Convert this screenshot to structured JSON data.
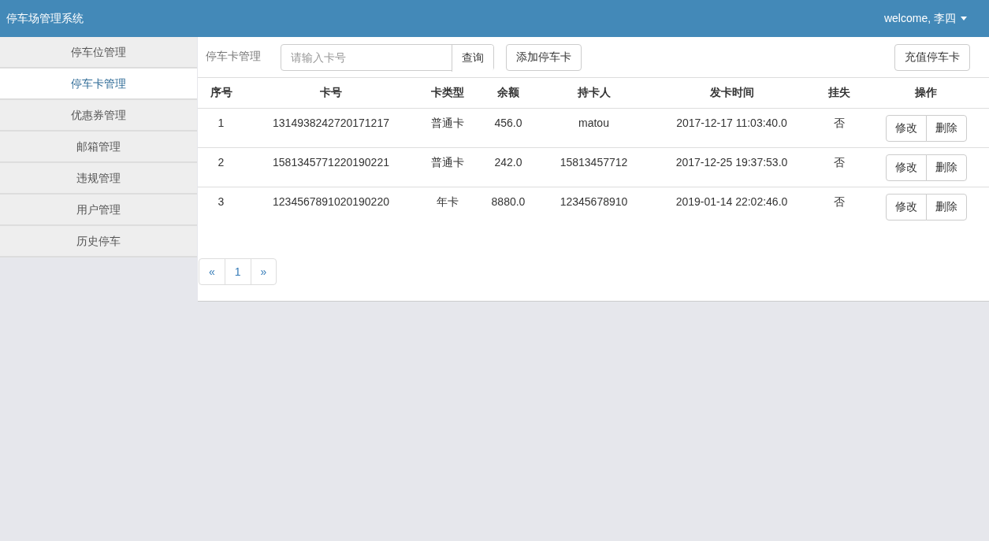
{
  "header": {
    "title": "停车场管理系统",
    "user_menu": "welcome, 李四"
  },
  "sidebar": {
    "items": [
      {
        "label": "停车位管理",
        "selected": false
      },
      {
        "label": "停车卡管理",
        "selected": true
      },
      {
        "label": "优惠券管理",
        "selected": false
      },
      {
        "label": "邮箱管理",
        "selected": false
      },
      {
        "label": "违规管理",
        "selected": false
      },
      {
        "label": "用户管理",
        "selected": false
      },
      {
        "label": "历史停车",
        "selected": false
      }
    ]
  },
  "toolbar": {
    "title": "停车卡管理",
    "search": {
      "placeholder": "请输入卡号"
    },
    "search_button": "查询",
    "add_button": "添加停车卡",
    "recharge_button": "充值停车卡"
  },
  "table": {
    "columns": [
      "序号",
      "卡号",
      "卡类型",
      "余额",
      "持卡人",
      "发卡时间",
      "挂失",
      "操作"
    ],
    "rows": [
      {
        "cells": [
          "1",
          "1314938242720171217",
          "普通卡",
          "456.0",
          "matou",
          "2017-12-17 11:03:40.0",
          "否"
        ],
        "actions": [
          "修改",
          "删除"
        ]
      },
      {
        "cells": [
          "2",
          "1581345771220190221",
          "普通卡",
          "242.0",
          "15813457712",
          "2017-12-25 19:37:53.0",
          "否"
        ],
        "actions": [
          "修改",
          "删除"
        ]
      },
      {
        "cells": [
          "3",
          "1234567891020190220",
          "年卡",
          "8880.0",
          "12345678910",
          "2019-01-14 22:02:46.0",
          "否"
        ],
        "actions": [
          "修改",
          "删除"
        ]
      }
    ]
  },
  "pagination": [
    "«",
    "1",
    "»"
  ]
}
